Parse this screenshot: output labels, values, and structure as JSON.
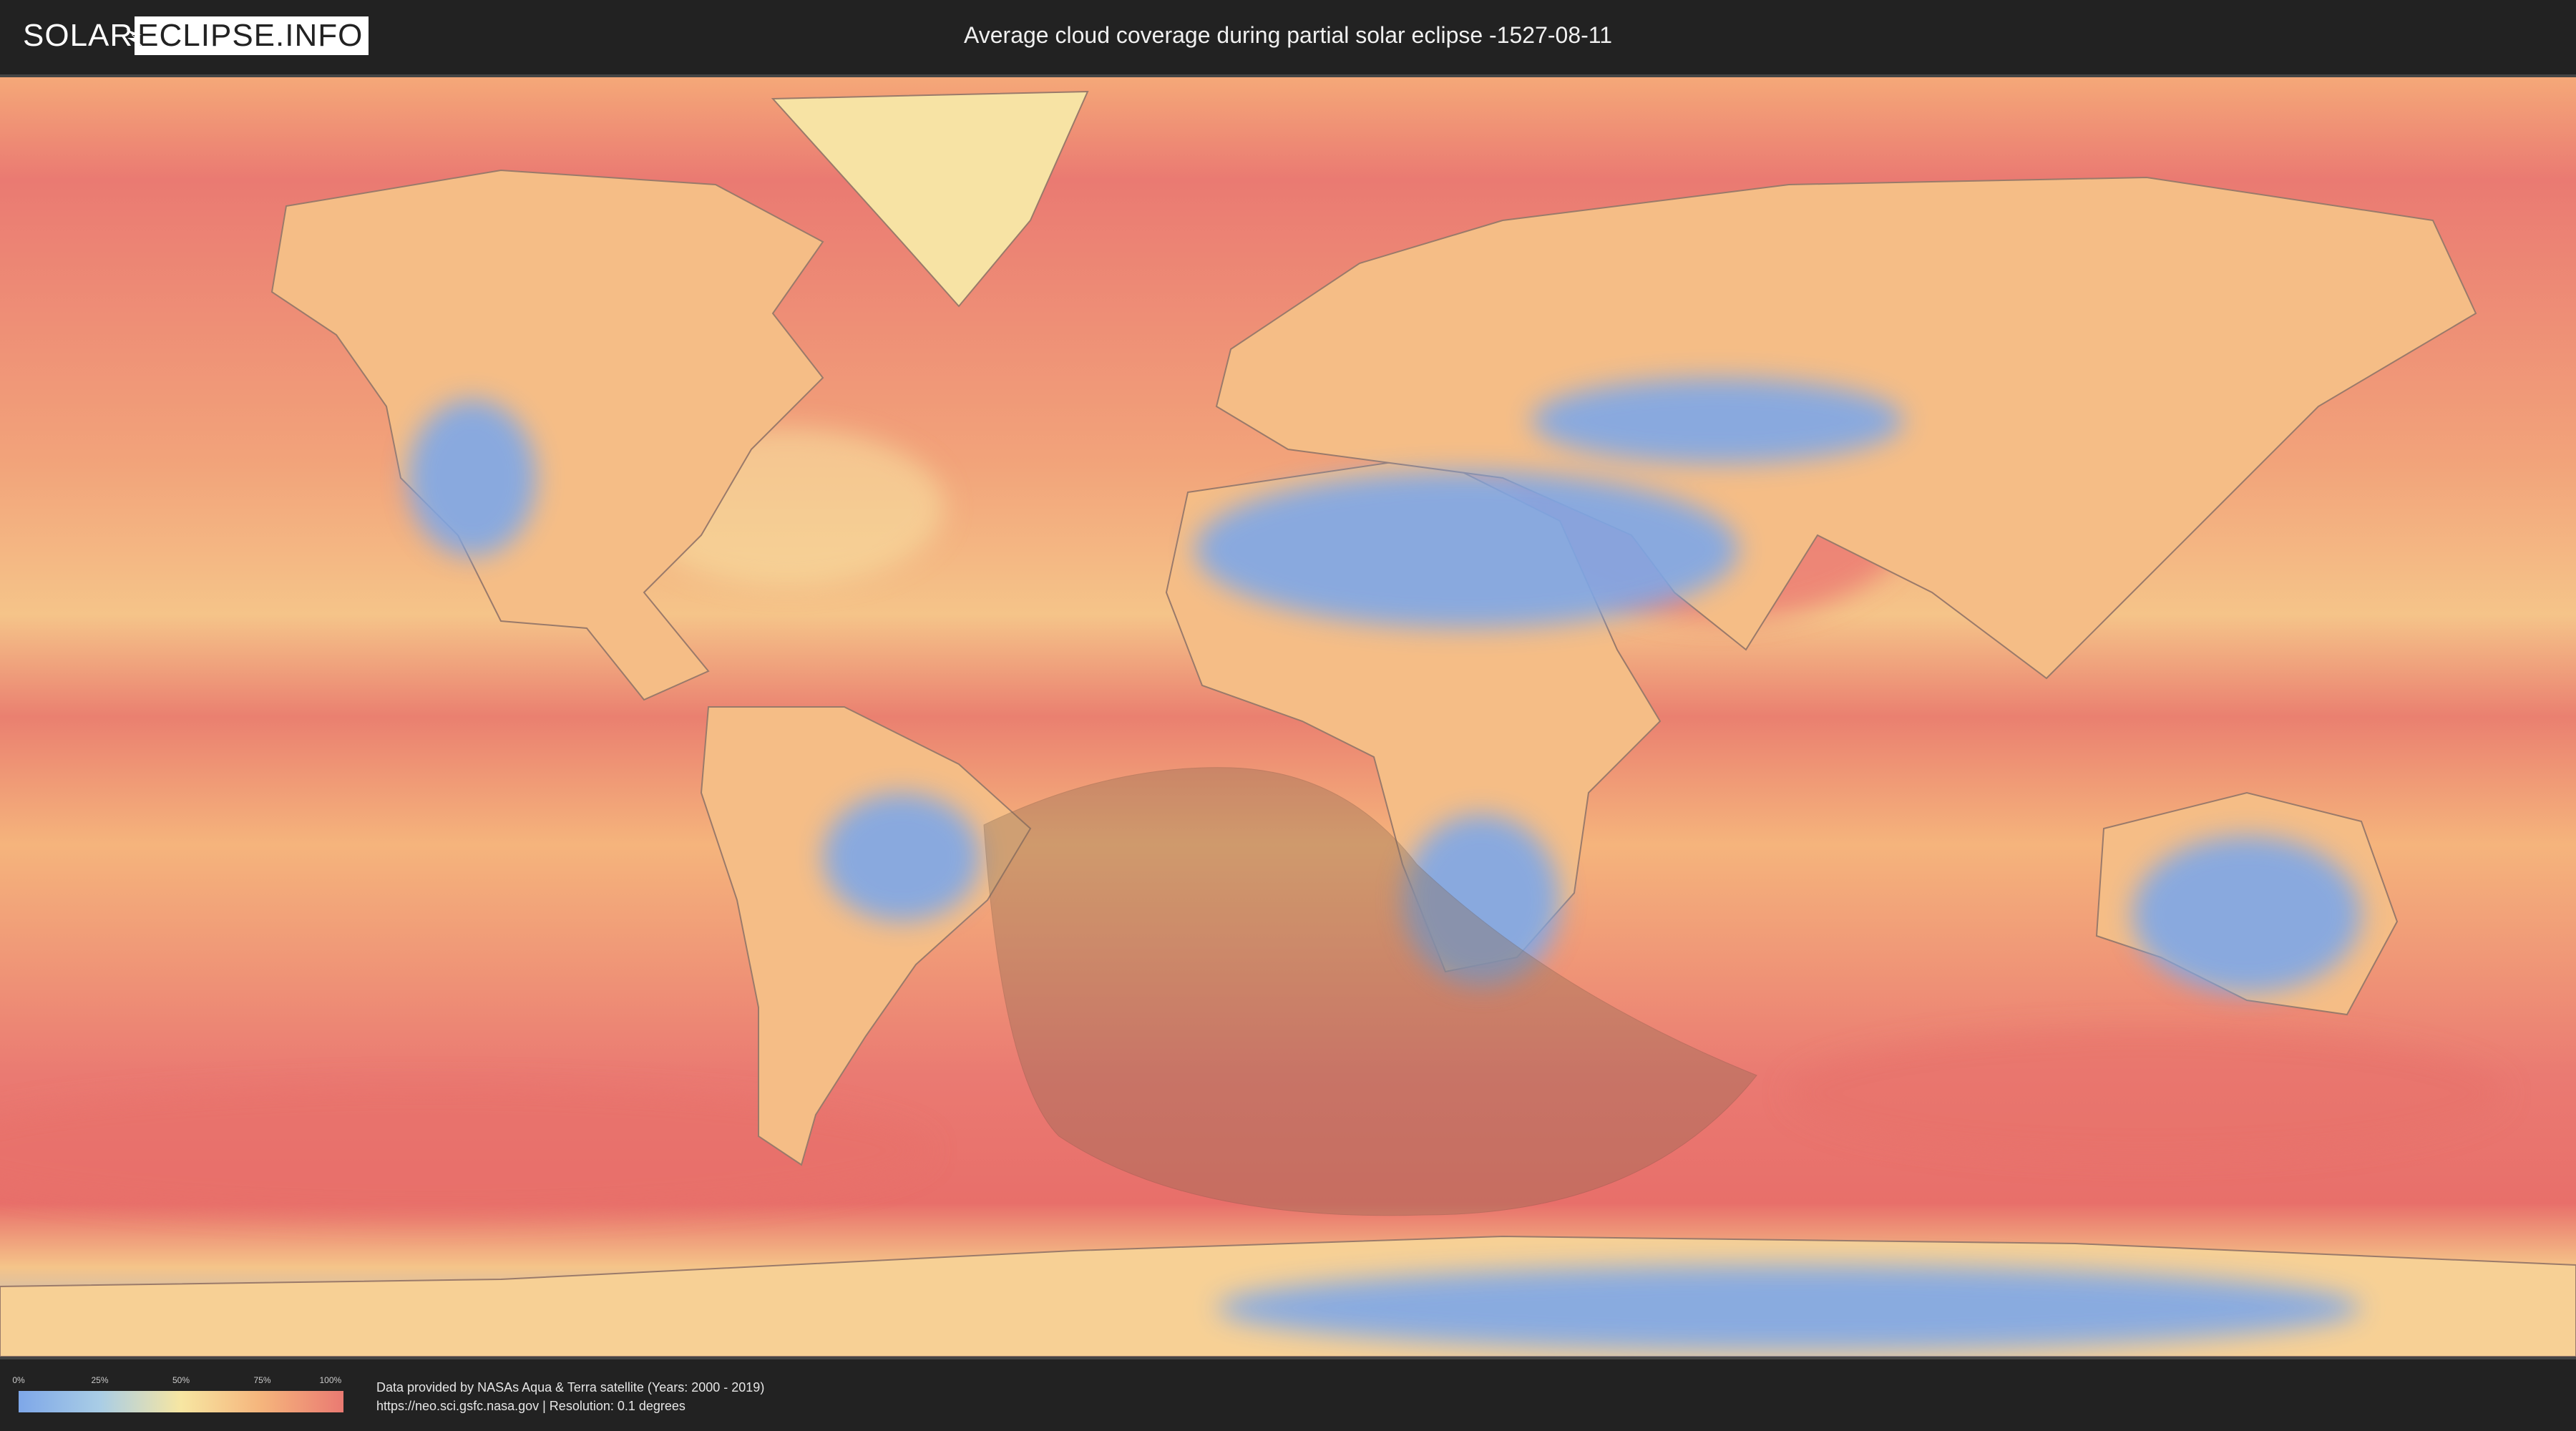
{
  "header": {
    "logo_left": "SOLAR",
    "logo_right": "ECLIPSE.INFO",
    "title": "Average cloud coverage during partial solar eclipse -1527-08-11"
  },
  "legend": {
    "ticks": [
      "0%",
      "25%",
      "50%",
      "75%",
      "100%"
    ],
    "colors": [
      "#7ea7e8",
      "#a9cde6",
      "#f7e6a2",
      "#f5b47c",
      "#ea7a72"
    ]
  },
  "credits": {
    "line1": "Data provided by NASAs Aqua & Terra satellite (Years: 2000 - 2019)",
    "line2": "https://neo.sci.gsfc.nasa.gov | Resolution: 0.1 degrees"
  },
  "map": {
    "clear_color": "#7ea7e8",
    "cloudy_color": "#ea7a72",
    "eclipse_shadow_color": "#8a6a50"
  }
}
